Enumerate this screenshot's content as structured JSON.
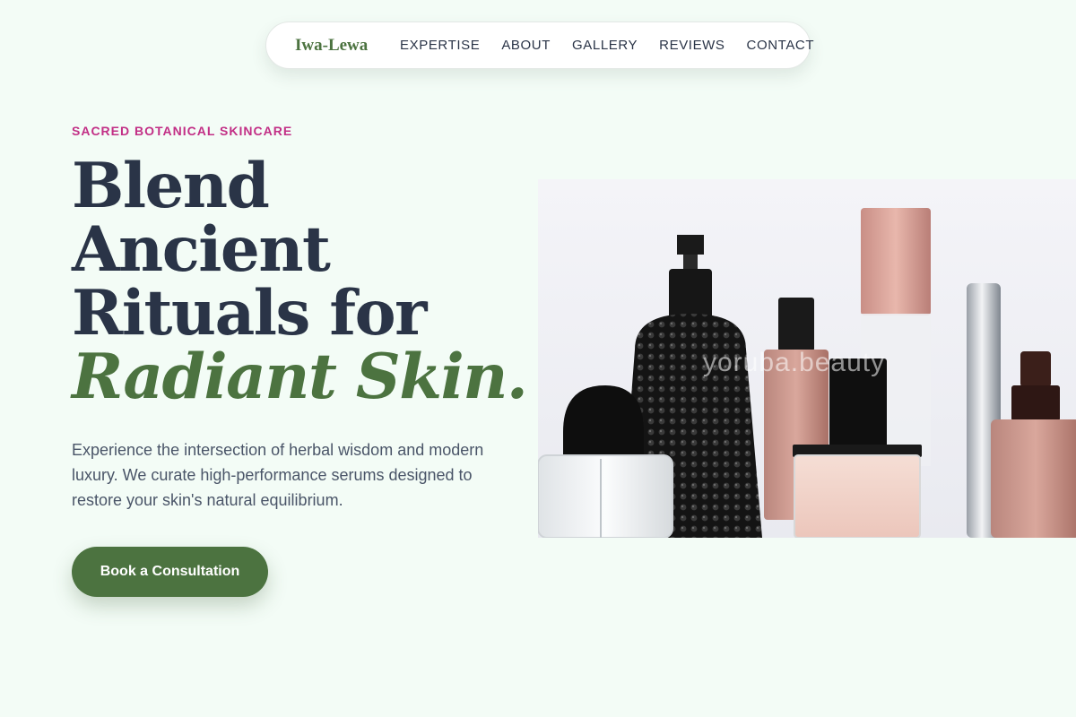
{
  "nav": {
    "logo": "Iwa-Lewa",
    "links": [
      "EXPERTISE",
      "ABOUT",
      "GALLERY",
      "REVIEWS",
      "CONTACT"
    ]
  },
  "hero": {
    "eyebrow": "SACRED BOTANICAL SKINCARE",
    "headline_lines": [
      "Blend",
      "Ancient",
      "Rituals for"
    ],
    "headline_accent": "Radiant Skin.",
    "description": "Experience the intersection of herbal wisdom and modern luxury. We curate high-performance serums designed to restore your skin's natural equilibrium.",
    "cta_label": "Book a Consultation",
    "image_watermark": "yoruba.beauty"
  },
  "colors": {
    "background": "#f3fcf6",
    "brand_green": "#4c7340",
    "accent_magenta": "#c22f86",
    "heading_navy": "#2a3447"
  }
}
